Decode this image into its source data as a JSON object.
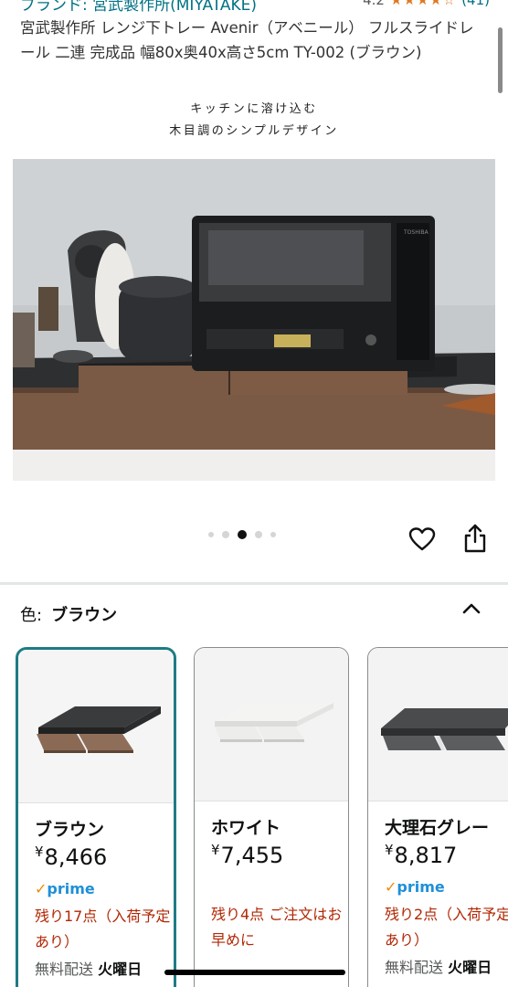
{
  "header": {
    "brand": "ブランド: 宮武製作所(MIYATAKE)",
    "rating_value": "4.2",
    "rating_stars": "★★★★☆",
    "rating_count": "(41)",
    "title": "宮武製作所 レンジ下トレー Avenir（アベニール） フルスライドレール 二連 完成品 幅80x奥40x高さ5cm TY-002 (ブラウン)"
  },
  "gallery": {
    "caption_line1": "キッチンに溶け込む",
    "caption_line2": "木目調のシンプルデザイン",
    "microwave_brand": "TOSHIBA",
    "dots": [
      {
        "state": "inactive"
      },
      {
        "state": "inactive"
      },
      {
        "state": "active"
      },
      {
        "state": "inactive"
      },
      {
        "state": "inactive"
      }
    ]
  },
  "actions": {
    "wishlist_icon": "heart-icon",
    "share_icon": "share-icon"
  },
  "variation": {
    "label": "色:",
    "selected": "ブラウン",
    "toggle_icon": "chevron-up-icon",
    "options": [
      {
        "name": "ブラウン",
        "price_symbol": "¥",
        "price": "8,466",
        "prime_check": "✓",
        "prime": "prime",
        "stock": "残り17点（入荷予定あり）",
        "shipping_label": "無料配送",
        "shipping_day": "火曜日",
        "selected": true
      },
      {
        "name": "ホワイト",
        "price_symbol": "¥",
        "price": "7,455",
        "prime_check": "",
        "prime": "",
        "stock": "残り4点 ご注文はお早めに",
        "shipping_label": "",
        "shipping_day": "",
        "selected": false
      },
      {
        "name": "大理石グレー",
        "price_symbol": "¥",
        "price": "8,817",
        "prime_check": "✓",
        "prime": "prime",
        "stock": "残り2点（入荷予定あり）",
        "shipping_label": "無料配送",
        "shipping_day": "火曜日",
        "selected": false
      }
    ]
  },
  "colors": {
    "link": "#007185",
    "star": "#de7921",
    "selected_border": "#1e7b84",
    "stock_red": "#b12704",
    "prime_blue": "#1f8fd8"
  }
}
